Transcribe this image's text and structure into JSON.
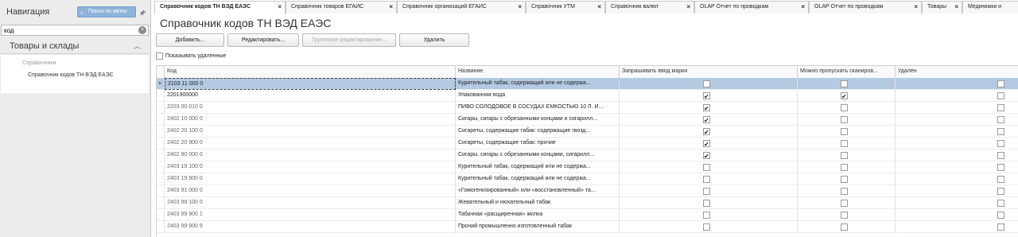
{
  "sidebar": {
    "title": "Навигация",
    "menu_search_label": "Поиск по меню",
    "search_value": "код",
    "section_title": "Товары и склады",
    "group_label": "Справочники",
    "item_label": "Справочник кодов ТН ВЭД ЕАЭС"
  },
  "tabs": [
    {
      "label": "Справочник кодов ТН ВЭД ЕАЭС",
      "active": true
    },
    {
      "label": "Справочник товаров ЕГАИС"
    },
    {
      "label": "Справочник организаций ЕГАИС"
    },
    {
      "label": "Справочник УТМ"
    },
    {
      "label": "Справочник валют"
    },
    {
      "label": "OLAP Отчет по проводкам"
    },
    {
      "label": "OLAP Отчет по проводкам"
    },
    {
      "label": "Товары"
    },
    {
      "label": "Медкнижки и"
    }
  ],
  "page": {
    "title": "Справочник кодов ТН ВЭД ЕАЭС",
    "buttons": {
      "add": "Добавить...",
      "edit": "Редактировать...",
      "group_edit": "Групповое редактирование...",
      "delete": "Удалить"
    },
    "show_deleted": "Показывать удаленные"
  },
  "grid": {
    "columns": {
      "code": "Код",
      "name": "Название",
      "require_mark": "Запрашивать ввод марки",
      "skip_scan": "Можно пропускать сканиров...",
      "deleted": "Удален"
    },
    "rows": [
      {
        "code": "2103 11 000 0",
        "name": "Курительный табак, содержащий или не содержа...",
        "require_mark": false,
        "skip_scan": false,
        "deleted": false,
        "selected": true
      },
      {
        "code": "2201900000",
        "name": "Упакованная вода",
        "require_mark": true,
        "skip_scan": true,
        "deleted": false
      },
      {
        "code": "2203 00 010 0",
        "name": "ПИВО СОЛОДОВОЕ В СОСУДАХ ЕМКОСТЬЮ 10 Л. И...",
        "require_mark": true,
        "skip_scan": false,
        "deleted": false
      },
      {
        "code": "2402 10 000 0",
        "name": "Сигары, сигары с обрезанными концами и сигарилл...",
        "require_mark": true,
        "skip_scan": false,
        "deleted": false
      },
      {
        "code": "2402 20 100 0",
        "name": "Сигареты, содержащие табак: содержащие гвозд...",
        "require_mark": true,
        "skip_scan": false,
        "deleted": false
      },
      {
        "code": "2402 20 900 0",
        "name": "Сигареты, содержащие табак: прочие",
        "require_mark": true,
        "skip_scan": false,
        "deleted": false
      },
      {
        "code": "2402 90 000 0",
        "name": "Сигары, сигары с обрезанными концами, сигарилл...",
        "require_mark": true,
        "skip_scan": false,
        "deleted": false
      },
      {
        "code": "2403 19 100 0",
        "name": "Курительный табак, содержащий или не содержа...",
        "require_mark": false,
        "skip_scan": false,
        "deleted": false
      },
      {
        "code": "2403 19 900 0",
        "name": "Курительный табак, содержащий или не содержа...",
        "require_mark": false,
        "skip_scan": false,
        "deleted": false
      },
      {
        "code": "2403 91 000 0",
        "name": "«Гомогенизированный» или «восстановленный» та...",
        "require_mark": false,
        "skip_scan": false,
        "deleted": false
      },
      {
        "code": "2403 99 100 0",
        "name": "Жевательный и нюхательный табак",
        "require_mark": false,
        "skip_scan": false,
        "deleted": false
      },
      {
        "code": "2403 99 900 1",
        "name": "Табачная «расщиренная» жилка",
        "require_mark": false,
        "skip_scan": false,
        "deleted": false
      },
      {
        "code": "2403 99 900 9",
        "name": "Прочий промышленно изготовленный табак",
        "require_mark": false,
        "skip_scan": false,
        "deleted": false
      }
    ]
  }
}
